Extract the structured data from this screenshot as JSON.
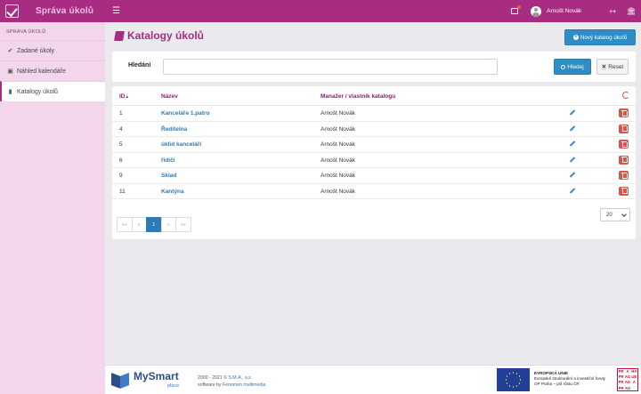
{
  "app": {
    "title": "Správa úkolů"
  },
  "topbar": {
    "user_name": "Arnošt Novák"
  },
  "sidebar": {
    "section_title": "SPRÁVA ÚKOLŮ",
    "items": [
      {
        "label": "Zadané úkoly",
        "icon": "check-circle-icon"
      },
      {
        "label": "Náhled kalendáře",
        "icon": "calendar-icon"
      },
      {
        "label": "Katalogy úkolů",
        "icon": "book-icon",
        "active": true
      }
    ]
  },
  "page": {
    "title": "Katalogy úkolů",
    "new_button": "Nový katalog úkolů"
  },
  "search": {
    "label": "Hledání",
    "value": "",
    "search_button": "Hledej",
    "reset_button": "Reset"
  },
  "table": {
    "columns": [
      "ID",
      "Název",
      "Manažer / vlastník katalogu"
    ],
    "sort_indicator": "▲",
    "rows": [
      {
        "id": "1",
        "name": "Kanceláře 1.patro",
        "owner": "Arnošt Novák"
      },
      {
        "id": "4",
        "name": "Ředitelna",
        "owner": "Arnošt Novák"
      },
      {
        "id": "5",
        "name": "úklid kanceláří",
        "owner": "Arnošt Novák"
      },
      {
        "id": "6",
        "name": "řidiči",
        "owner": "Arnošt Novák"
      },
      {
        "id": "9",
        "name": "Sklad",
        "owner": "Arnošt Novák"
      },
      {
        "id": "11",
        "name": "Kantýna",
        "owner": "Arnošt Novák"
      }
    ]
  },
  "pagination": {
    "first": "««",
    "prev": "«",
    "current": "1",
    "next": "»",
    "last": "»»",
    "per_page": "20"
  },
  "footer": {
    "brand": "MySmart",
    "brand_sub": "place",
    "copyright": "2000 - 2021 © ",
    "company": "S.M.A., a.s.",
    "software_by": "software by ",
    "vendor": "Fenomen multimedia",
    "eu_line1": "EVROPSKÁ UNIE",
    "eu_line2": "Evropské strukturální a investiční fondy",
    "eu_line3": "OP Praha – pól růstu ČR",
    "praha_letters": [
      "PRA",
      "HA",
      "",
      "PRA",
      "GUE",
      "",
      "PRA",
      "GA",
      "",
      "PRA",
      "G",
      "",
      "PRA",
      "G",
      ""
    ]
  },
  "colors": {
    "brand": "#a72c82",
    "primary": "#2f8cc4",
    "danger": "#d9534f",
    "sidebar": "#f3d6ec"
  }
}
